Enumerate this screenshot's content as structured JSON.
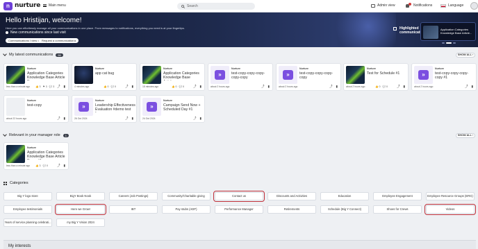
{
  "nav": {
    "brand": "nurture",
    "main_menu": "Main menu",
    "search_placeholder": "Search",
    "admin_view": "Admin view",
    "notifications": "Notifications",
    "language": "Language"
  },
  "hero": {
    "greeting": "Hello Hristijan, welcome!",
    "subtitle": "Here you can effortlessly manage all your communications in one place. From messages to notifications, everything you need is at your fingertips.",
    "new_comms": "New communications since last visit",
    "btn_view": "Communications I view",
    "btn_request": "Request a communication",
    "highlighted_label": "Highlighted communications",
    "highlighted_title": "Application Categories Knowledge Base Article..."
  },
  "latest": {
    "heading": "My latest communications",
    "count": "96",
    "show_all": "SHOW ALL",
    "cards": [
      {
        "source": "Nurture",
        "title": "Application Categories Knowledge Base Article D...",
        "meta": "less than a minute ago",
        "likes": "3",
        "comments": "3",
        "views": "3"
      },
      {
        "source": "Nurture",
        "title": "app cat bug",
        "meta": "4 minutes ago",
        "likes": "0",
        "comments": "0"
      },
      {
        "source": "Nurture",
        "title": "Application Categories Knowledge Base Article...",
        "meta": "15 minutes ago",
        "likes": "0",
        "comments": "0"
      },
      {
        "source": "Nurture",
        "title": "test-copy-copy-copy-copy-copy",
        "meta": "about 2 hours ago"
      },
      {
        "source": "Nurture",
        "title": "test-copy-copy-copy-copy",
        "meta": "about 2 hours ago"
      },
      {
        "source": "Nurture",
        "title": "Test for Schedule #1",
        "meta": "about 2 hours ago",
        "likes": "0",
        "comments": "0"
      },
      {
        "source": "Nurture",
        "title": "test-copy-copy-copy-copy #1",
        "meta": "about 2 hours ago"
      },
      {
        "source": "Nurture",
        "title": "test-copy",
        "meta": "about 22 hours ago"
      },
      {
        "source": "Nurture",
        "title": "Leadership Effectiveness Evaluation #demo test fo...",
        "meta": "26 Oct 2024"
      },
      {
        "source": "Nurture",
        "title": "Campaign Send Now + Scheduled Day #1",
        "meta": "24 Oct 2024"
      }
    ]
  },
  "manager": {
    "heading": "Relevant in your manager role",
    "count": "1",
    "show_all": "SHOW ALL",
    "card": {
      "source": "Nurture",
      "title": "Application Categories Knowledge Base Article Demo #1",
      "meta": "less than a minute ago",
      "likes": "3",
      "comments": "0"
    }
  },
  "categories": {
    "heading": "Categories",
    "items": [
      "Big Y logo store",
      "BigY Book Nook",
      "Careers (Job Postings)",
      "Community/Charitable giving",
      "Contact us",
      "Discounts and Activities",
      "Education",
      "Employee Engagement",
      "Employee Resource Groups (ERG)",
      "Employee testimonials",
      "Here we Grow!",
      "IBT",
      "Pay stubs (ADP)",
      "Performance Manager",
      "Retirements",
      "Schedule (Big Y Connect)",
      "Shoes for Crews",
      "Videos",
      "Years of service planning celebrati...",
      "my Big Y Vision 2024"
    ]
  },
  "interests": {
    "heading": "My interests"
  },
  "icons": [
    "hamburger-icon",
    "search-icon",
    "admin-icon",
    "bell-icon",
    "flag-icon",
    "chevron-down-icon",
    "grid-icon",
    "share-icon",
    "bookmark-icon"
  ]
}
